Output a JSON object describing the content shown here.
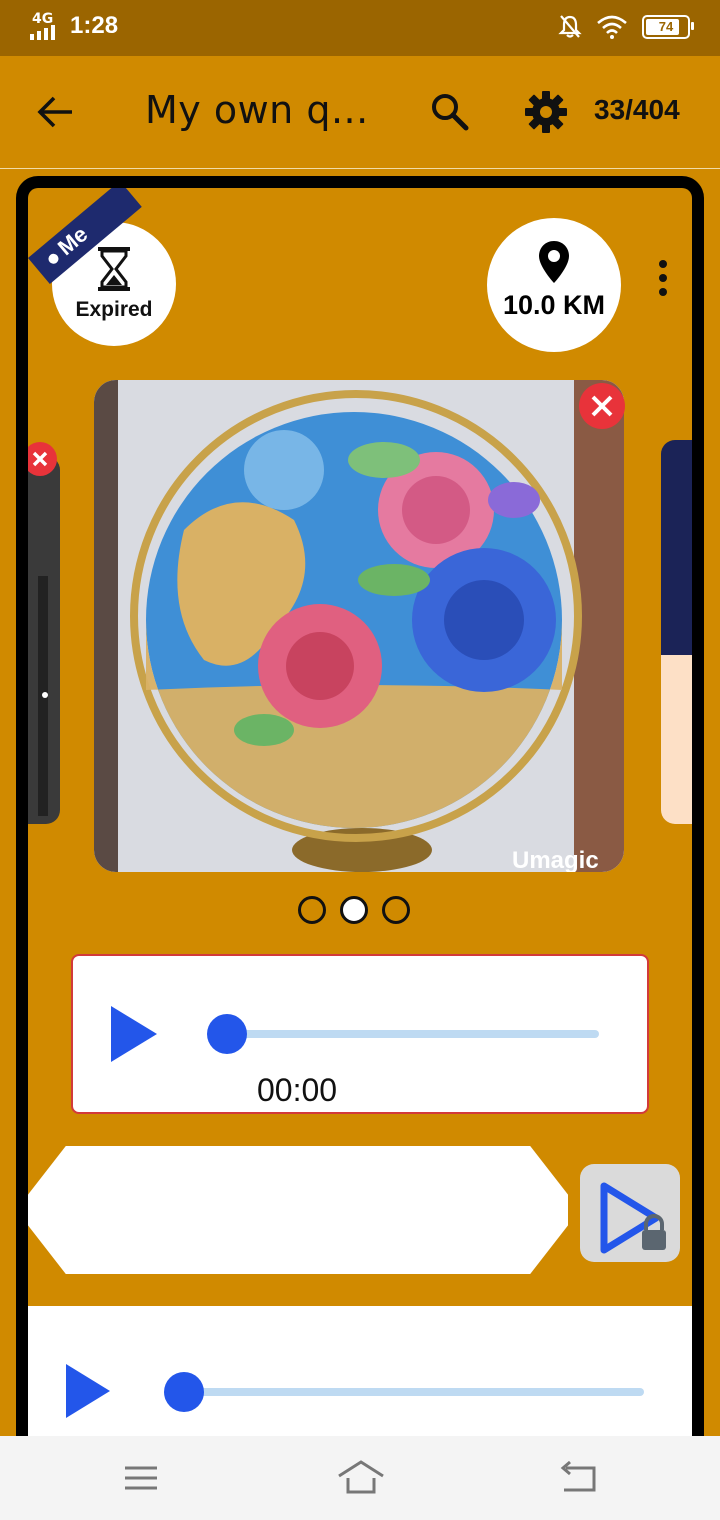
{
  "status_bar": {
    "network": "4G",
    "time": "1:28",
    "battery": 74,
    "battery_label": "74",
    "icons": [
      "signal-icon",
      "mute-icon",
      "wifi-icon",
      "battery-icon"
    ]
  },
  "app_bar": {
    "title": "My own q...",
    "counter": "33/404",
    "icons": [
      "back-arrow-icon",
      "search-icon",
      "gear-icon"
    ]
  },
  "card": {
    "owner_tag": "Me",
    "expired_label": "Expired",
    "distance_label": "10.0 KM",
    "image_watermark": "Umagic",
    "carousel": {
      "count": 3,
      "active_index": 1
    },
    "audio_player": {
      "time": "00:00",
      "progress": 0
    },
    "second_player": {
      "progress": 0
    }
  },
  "colors": {
    "accent": "#d08a00",
    "status_bar": "#9b6500",
    "play_blue": "#2356ea",
    "track": "#bedaf2",
    "close_red": "#e8333a",
    "ribbon": "#1e2a6e"
  },
  "nav_bar": {
    "icons": [
      "menu-icon",
      "home-icon",
      "back-icon"
    ]
  }
}
